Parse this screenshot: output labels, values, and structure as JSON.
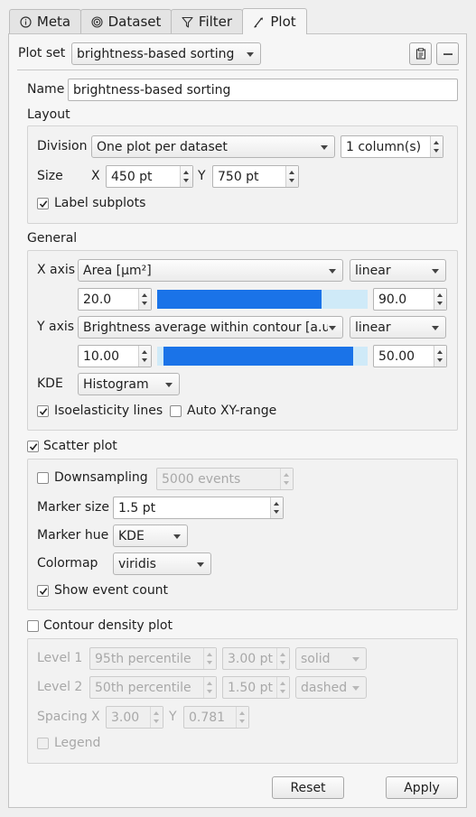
{
  "tabs": [
    {
      "label": "Meta",
      "icon": "info-icon"
    },
    {
      "label": "Dataset",
      "icon": "dataset-icon"
    },
    {
      "label": "Filter",
      "icon": "filter-icon"
    },
    {
      "label": "Plot",
      "icon": "plot-icon",
      "active": true
    }
  ],
  "plot_set": {
    "label": "Plot set",
    "value": "brightness-based sorting"
  },
  "name": {
    "label": "Name",
    "value": "brightness-based sorting"
  },
  "layout": {
    "title": "Layout",
    "division_label": "Division",
    "division_value": "One plot per dataset",
    "columns_value": "1 column(s)",
    "size_label": "Size",
    "x_label": "X",
    "x_value": "450 pt",
    "y_label": "Y",
    "y_value": "750 pt",
    "label_subplots": "Label subplots",
    "label_subplots_checked": true
  },
  "general": {
    "title": "General",
    "x_axis_label": "X axis",
    "x_axis_value": "Area [µm²]",
    "x_scale": "linear",
    "x_min": "20.0",
    "x_max": "90.0",
    "x_range_fraction": [
      0.0,
      0.78
    ],
    "y_axis_label": "Y axis",
    "y_axis_value": "Brightness average within contour [a.u.]",
    "y_scale": "linear",
    "y_min": "10.00",
    "y_max": "50.00",
    "y_range_fraction": [
      0.03,
      0.93
    ],
    "kde_label": "KDE",
    "kde_value": "Histogram",
    "isoelasticity": "Isoelasticity lines",
    "isoelasticity_checked": true,
    "auto_xy": "Auto XY-range",
    "auto_xy_checked": false
  },
  "scatter": {
    "title": "Scatter plot",
    "checked": true,
    "downsampling_label": "Downsampling",
    "downsampling_checked": false,
    "downsampling_value": "5000 events",
    "marker_size_label": "Marker size",
    "marker_size_value": "1.5 pt",
    "marker_hue_label": "Marker hue",
    "marker_hue_value": "KDE",
    "colormap_label": "Colormap",
    "colormap_value": "viridis",
    "event_count_label": "Show event count",
    "event_count_checked": true
  },
  "contour": {
    "title": "Contour density plot",
    "checked": false,
    "level1_label": "Level 1",
    "level1_percentile": "95th percentile",
    "level1_width": "3.00 pt",
    "level1_style": "solid",
    "level2_label": "Level 2",
    "level2_percentile": "50th percentile",
    "level2_width": "1.50 pt",
    "level2_style": "dashed",
    "spacing_label": "Spacing",
    "x_label": "X",
    "x_value": "3.00",
    "y_label": "Y",
    "y_value": "0.781",
    "legend_label": "Legend"
  },
  "buttons": {
    "reset": "Reset",
    "apply": "Apply"
  }
}
